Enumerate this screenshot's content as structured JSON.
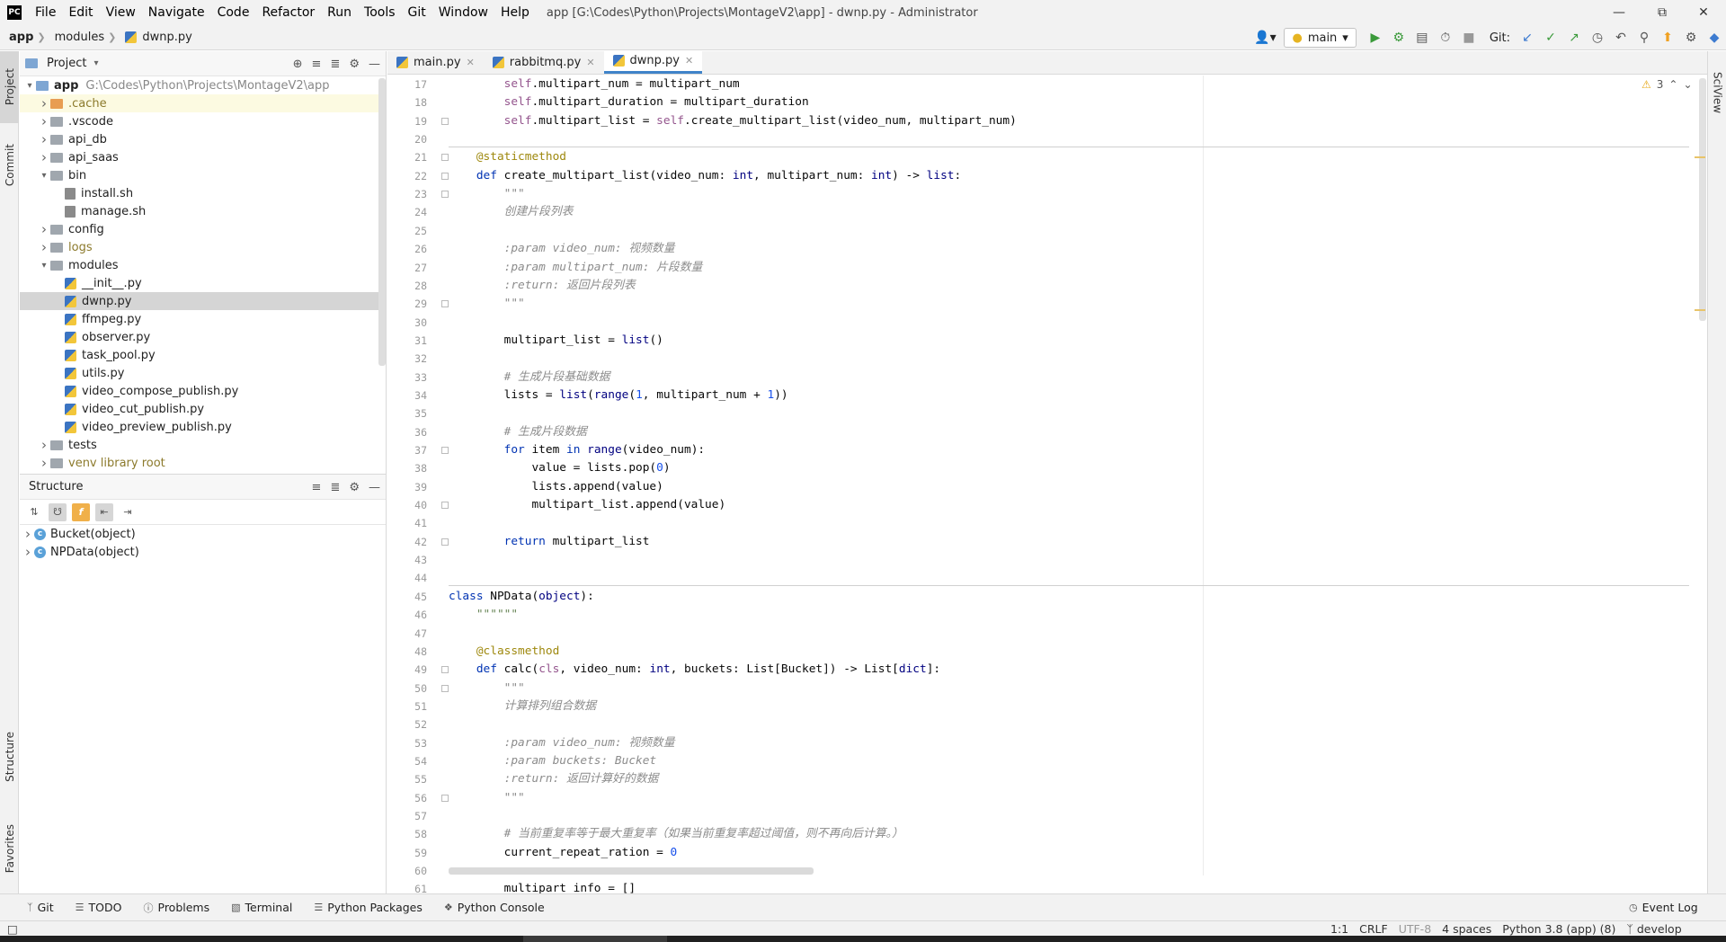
{
  "titlebar": {
    "logo": "PC",
    "menus": [
      "File",
      "Edit",
      "View",
      "Navigate",
      "Code",
      "Refactor",
      "Run",
      "Tools",
      "Git",
      "Window",
      "Help"
    ],
    "window_title": "app [G:\\Codes\\Python\\Projects\\MontageV2\\app] - dwnp.py - Administrator"
  },
  "navbar": {
    "crumbs": [
      "app",
      "modules",
      "dwnp.py"
    ],
    "run_config": "main",
    "git_label": "Git:"
  },
  "left_tabs": {
    "project": "Project",
    "commit": "Commit",
    "structure": "Structure",
    "favorites": "Favorites"
  },
  "right_tabs": {
    "sciview": "SciView"
  },
  "project": {
    "title": "Project",
    "root_name": "app",
    "root_path": "G:\\Codes\\Python\\Projects\\MontageV2\\app",
    "items": [
      {
        "label": ".cache",
        "kind": "folder-orange",
        "depth": 1,
        "expand": "right",
        "style": "dim",
        "highlight": true
      },
      {
        "label": ".vscode",
        "kind": "folder",
        "depth": 1,
        "expand": "right"
      },
      {
        "label": "api_db",
        "kind": "folder",
        "depth": 1,
        "expand": "right"
      },
      {
        "label": "api_saas",
        "kind": "folder",
        "depth": 1,
        "expand": "right"
      },
      {
        "label": "bin",
        "kind": "folder",
        "depth": 1,
        "expand": "down"
      },
      {
        "label": "install.sh",
        "kind": "sh",
        "depth": 2
      },
      {
        "label": "manage.sh",
        "kind": "sh",
        "depth": 2
      },
      {
        "label": "config",
        "kind": "folder",
        "depth": 1,
        "expand": "right"
      },
      {
        "label": "logs",
        "kind": "folder",
        "depth": 1,
        "expand": "right",
        "style": "dim"
      },
      {
        "label": "modules",
        "kind": "folder",
        "depth": 1,
        "expand": "down"
      },
      {
        "label": "__init__.py",
        "kind": "py",
        "depth": 2
      },
      {
        "label": "dwnp.py",
        "kind": "py",
        "depth": 2,
        "selected": true
      },
      {
        "label": "ffmpeg.py",
        "kind": "py",
        "depth": 2
      },
      {
        "label": "observer.py",
        "kind": "py",
        "depth": 2
      },
      {
        "label": "task_pool.py",
        "kind": "py",
        "depth": 2
      },
      {
        "label": "utils.py",
        "kind": "py",
        "depth": 2
      },
      {
        "label": "video_compose_publish.py",
        "kind": "py",
        "depth": 2
      },
      {
        "label": "video_cut_publish.py",
        "kind": "py",
        "depth": 2
      },
      {
        "label": "video_preview_publish.py",
        "kind": "py",
        "depth": 2
      },
      {
        "label": "tests",
        "kind": "folder",
        "depth": 1,
        "expand": "right"
      },
      {
        "label": "venv  library root",
        "kind": "folder",
        "depth": 1,
        "expand": "right",
        "style": "dim"
      }
    ]
  },
  "structure": {
    "title": "Structure",
    "items": [
      "Bucket(object)",
      "NPData(object)"
    ]
  },
  "editor": {
    "tabs": [
      {
        "label": "main.py",
        "active": false
      },
      {
        "label": "rabbitmq.py",
        "active": false
      },
      {
        "label": "dwnp.py",
        "active": true
      }
    ],
    "warnings": "3",
    "lines": [
      {
        "n": "17",
        "html": "        <span class='selfk'>self</span>.multipart_num = multipart_num"
      },
      {
        "n": "18",
        "html": "        <span class='selfk'>self</span>.multipart_duration = multipart_duration"
      },
      {
        "n": "19",
        "html": "        <span class='selfk'>self</span>.multipart_list = <span class='selfk'>self</span>.create_multipart_list(video_num, multipart_num)"
      },
      {
        "n": "20",
        "html": ""
      },
      {
        "n": "21",
        "html": "    <span class='deco'>@staticmethod</span>"
      },
      {
        "n": "22",
        "html": "    <span class='kw'>def</span> create_multipart_list(video_num: <span class='builtin'>int</span>, multipart_num: <span class='builtin'>int</span>) -&gt; <span class='builtin'>list</span>:"
      },
      {
        "n": "23",
        "html": "        <span class='doc'>\"\"\"</span>"
      },
      {
        "n": "24",
        "html": "        <span class='doc'>创建片段列表</span>"
      },
      {
        "n": "25",
        "html": ""
      },
      {
        "n": "26",
        "html": "        <span class='doc'>:param video_num: 视频数量</span>"
      },
      {
        "n": "27",
        "html": "        <span class='doc'>:param multipart_num: 片段数量</span>"
      },
      {
        "n": "28",
        "html": "        <span class='doc'>:return: 返回片段列表</span>"
      },
      {
        "n": "29",
        "html": "        <span class='doc'>\"\"\"</span>"
      },
      {
        "n": "30",
        "html": ""
      },
      {
        "n": "31",
        "html": "        multipart_list = <span class='builtin'>list</span>()"
      },
      {
        "n": "32",
        "html": ""
      },
      {
        "n": "33",
        "html": "        <span class='cmt'># 生成片段基础数据</span>"
      },
      {
        "n": "34",
        "html": "        lists = <span class='builtin'>list</span>(<span class='builtin'>range</span>(<span class='num'>1</span>, multipart_num + <span class='num'>1</span>))"
      },
      {
        "n": "35",
        "html": ""
      },
      {
        "n": "36",
        "html": "        <span class='cmt'># 生成片段数据</span>"
      },
      {
        "n": "37",
        "html": "        <span class='kw'>for</span> item <span class='kw'>in</span> <span class='builtin'>range</span>(video_num):"
      },
      {
        "n": "38",
        "html": "            value = lists.pop(<span class='num'>0</span>)"
      },
      {
        "n": "39",
        "html": "            lists.append(value)"
      },
      {
        "n": "40",
        "html": "            multipart_list.append(value)"
      },
      {
        "n": "41",
        "html": ""
      },
      {
        "n": "42",
        "html": "        <span class='kw'>return</span> multipart_list"
      },
      {
        "n": "43",
        "html": ""
      },
      {
        "n": "44",
        "html": ""
      },
      {
        "n": "45",
        "html": "<span class='kw'>class</span> NPData(<span class='builtin'>object</span>):"
      },
      {
        "n": "46",
        "html": "    <span class='docs'>\"\"\"\"\"\"</span>"
      },
      {
        "n": "47",
        "html": ""
      },
      {
        "n": "48",
        "html": "    <span class='deco'>@classmethod</span>"
      },
      {
        "n": "49",
        "html": "    <span class='kw'>def</span> calc(<span class='selfk'>cls</span>, video_num: <span class='builtin'>int</span>, buckets: List[Bucket]) -&gt; List[<span class='builtin'>dict</span>]:"
      },
      {
        "n": "50",
        "html": "        <span class='doc'>\"\"\"</span>"
      },
      {
        "n": "51",
        "html": "        <span class='doc'>计算排列组合数据</span>"
      },
      {
        "n": "52",
        "html": ""
      },
      {
        "n": "53",
        "html": "        <span class='doc'>:param video_num: 视频数量</span>"
      },
      {
        "n": "54",
        "html": "        <span class='doc'>:param buckets: Bucket</span>"
      },
      {
        "n": "55",
        "html": "        <span class='doc'>:return: 返回计算好的数据</span>"
      },
      {
        "n": "56",
        "html": "        <span class='doc'>\"\"\"</span>"
      },
      {
        "n": "57",
        "html": ""
      },
      {
        "n": "58",
        "html": "        <span class='cmt'># 当前重复率等于最大重复率（如果当前重复率超过阈值，则不再向后计算。）</span>"
      },
      {
        "n": "59",
        "html": "        current_repeat_ration = <span class='num'>0</span>"
      },
      {
        "n": "60",
        "html": ""
      },
      {
        "n": "61",
        "html": "        multipart_info = []"
      }
    ]
  },
  "bottom_tabs": [
    "Git",
    "TODO",
    "Problems",
    "Terminal",
    "Python Packages",
    "Python Console"
  ],
  "event_log": "Event Log",
  "status": {
    "position": "1:1",
    "line_sep": "CRLF",
    "encoding": "UTF-8",
    "indent": "4 spaces",
    "interpreter": "Python 3.8 (app) (8)",
    "branch": "develop"
  }
}
